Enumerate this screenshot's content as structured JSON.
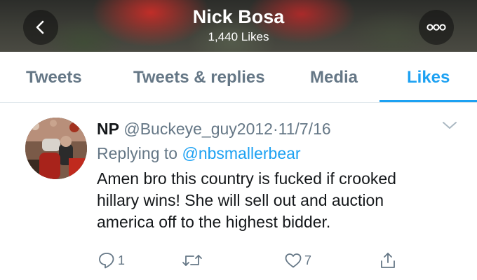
{
  "header": {
    "title": "Nick Bosa",
    "subtitle": "1,440 Likes",
    "back_icon": "chevron-left-icon",
    "more_icon": "more-dots-icon"
  },
  "tabs": [
    {
      "label": "Tweets",
      "active": false
    },
    {
      "label": "Tweets & replies",
      "active": false
    },
    {
      "label": "Media",
      "active": false
    },
    {
      "label": "Likes",
      "active": true
    }
  ],
  "tweet": {
    "name": "NP",
    "handle": "@Buckeye_guy2012",
    "separator": "·",
    "date": "11/7/16",
    "replying_prefix": "Replying to",
    "replying_to": "@nbsmallerbear",
    "text_lines": [
      "Amen bro this country is fucked if crooked",
      "hillary wins! She will sell out and auction",
      "america off to the highest bidder."
    ],
    "actions": {
      "reply_count": "1",
      "retweet_count": "",
      "like_count": "7"
    }
  },
  "colors": {
    "accent": "#1da1f2",
    "muted": "#657786",
    "text": "#14171a",
    "divider": "#e1e8ed"
  }
}
